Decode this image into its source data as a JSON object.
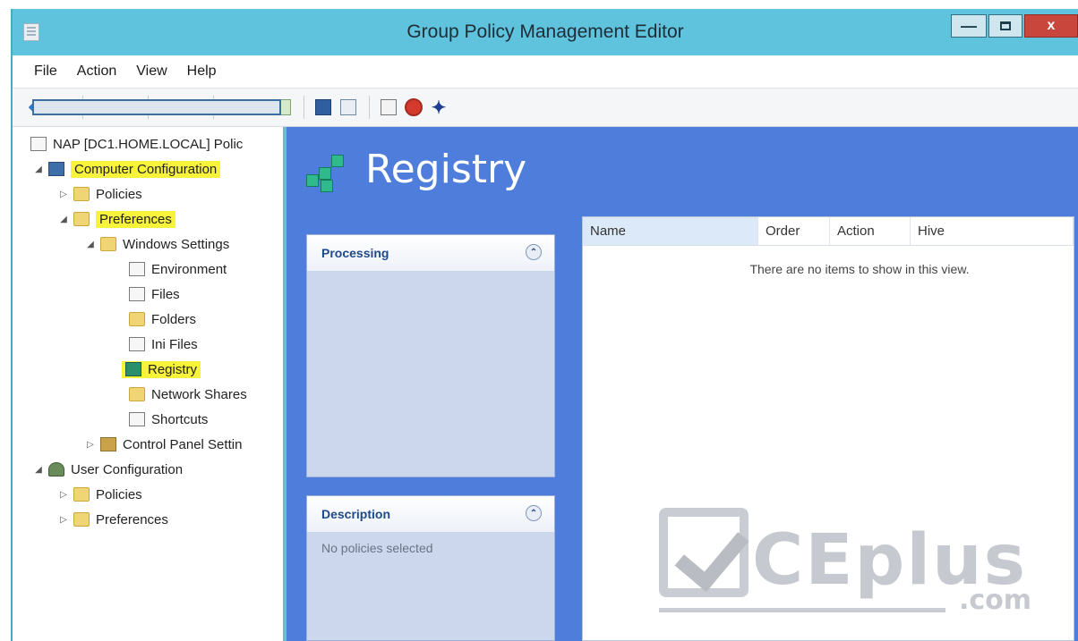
{
  "window": {
    "title": "Group Policy Management Editor",
    "min_label": "—",
    "close_label": "x"
  },
  "menu": [
    "File",
    "Action",
    "View",
    "Help"
  ],
  "tree": {
    "root": "NAP [DC1.HOME.LOCAL] Polic",
    "computer_config": "Computer Configuration",
    "policies": "Policies",
    "preferences": "Preferences",
    "windows_settings": "Windows Settings",
    "environment": "Environment",
    "files": "Files",
    "folders": "Folders",
    "ini_files": "Ini Files",
    "registry": "Registry",
    "network_shares": "Network Shares",
    "shortcuts": "Shortcuts",
    "control_panel": "Control Panel Settin",
    "user_config": "User Configuration",
    "user_policies": "Policies",
    "user_preferences": "Preferences"
  },
  "content": {
    "heading": "Registry",
    "processing_title": "Processing",
    "description_title": "Description",
    "description_text": "No policies selected",
    "columns": [
      "Name",
      "Order",
      "Action",
      "Hive"
    ],
    "empty_message": "There are no items to show in this view."
  },
  "watermark": {
    "brand": "CEplus",
    "suffix": ".com"
  }
}
